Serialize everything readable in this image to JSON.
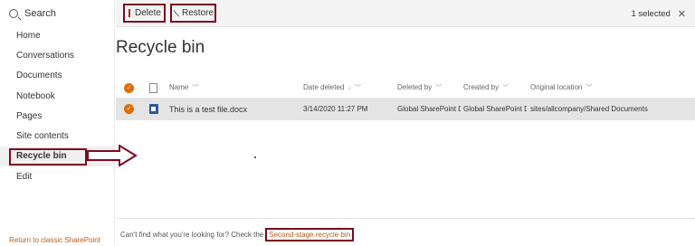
{
  "sidebar": {
    "search_label": "Search",
    "items": [
      {
        "label": "Home"
      },
      {
        "label": "Conversations"
      },
      {
        "label": "Documents"
      },
      {
        "label": "Notebook"
      },
      {
        "label": "Pages"
      },
      {
        "label": "Site contents"
      },
      {
        "label": "Recycle bin",
        "selected": true
      },
      {
        "label": "Edit"
      }
    ],
    "classic_link": "Return to classic SharePoint"
  },
  "toolbar": {
    "delete_label": "Delete",
    "restore_label": "Restore",
    "selected_count": "1 selected"
  },
  "page": {
    "title": "Recycle bin"
  },
  "table": {
    "columns": {
      "name": "Name",
      "date_deleted": "Date deleted",
      "deleted_by": "Deleted by",
      "created_by": "Created by",
      "original_location": "Original location"
    },
    "rows": [
      {
        "name": "This is a test file.docx",
        "date_deleted": "3/14/2020 11:27 PM",
        "deleted_by": "Global SharePoint Di",
        "created_by": "Global SharePoint Di",
        "original_location": "sites/allcompany/Shared Documents",
        "selected": true
      }
    ]
  },
  "footer": {
    "text": "Can't find what you're looking for? Check the",
    "link": "Second-stage recycle bin"
  },
  "colors": {
    "accent": "#e06c00",
    "highlight_border": "#7b0a1f",
    "link": "#b85c1a",
    "selected_row": "#e4e4e4"
  },
  "icons": {
    "search": "search-icon",
    "delete": "trash-icon",
    "restore": "restore-icon",
    "close": "close-icon",
    "file": "word-doc-icon"
  }
}
